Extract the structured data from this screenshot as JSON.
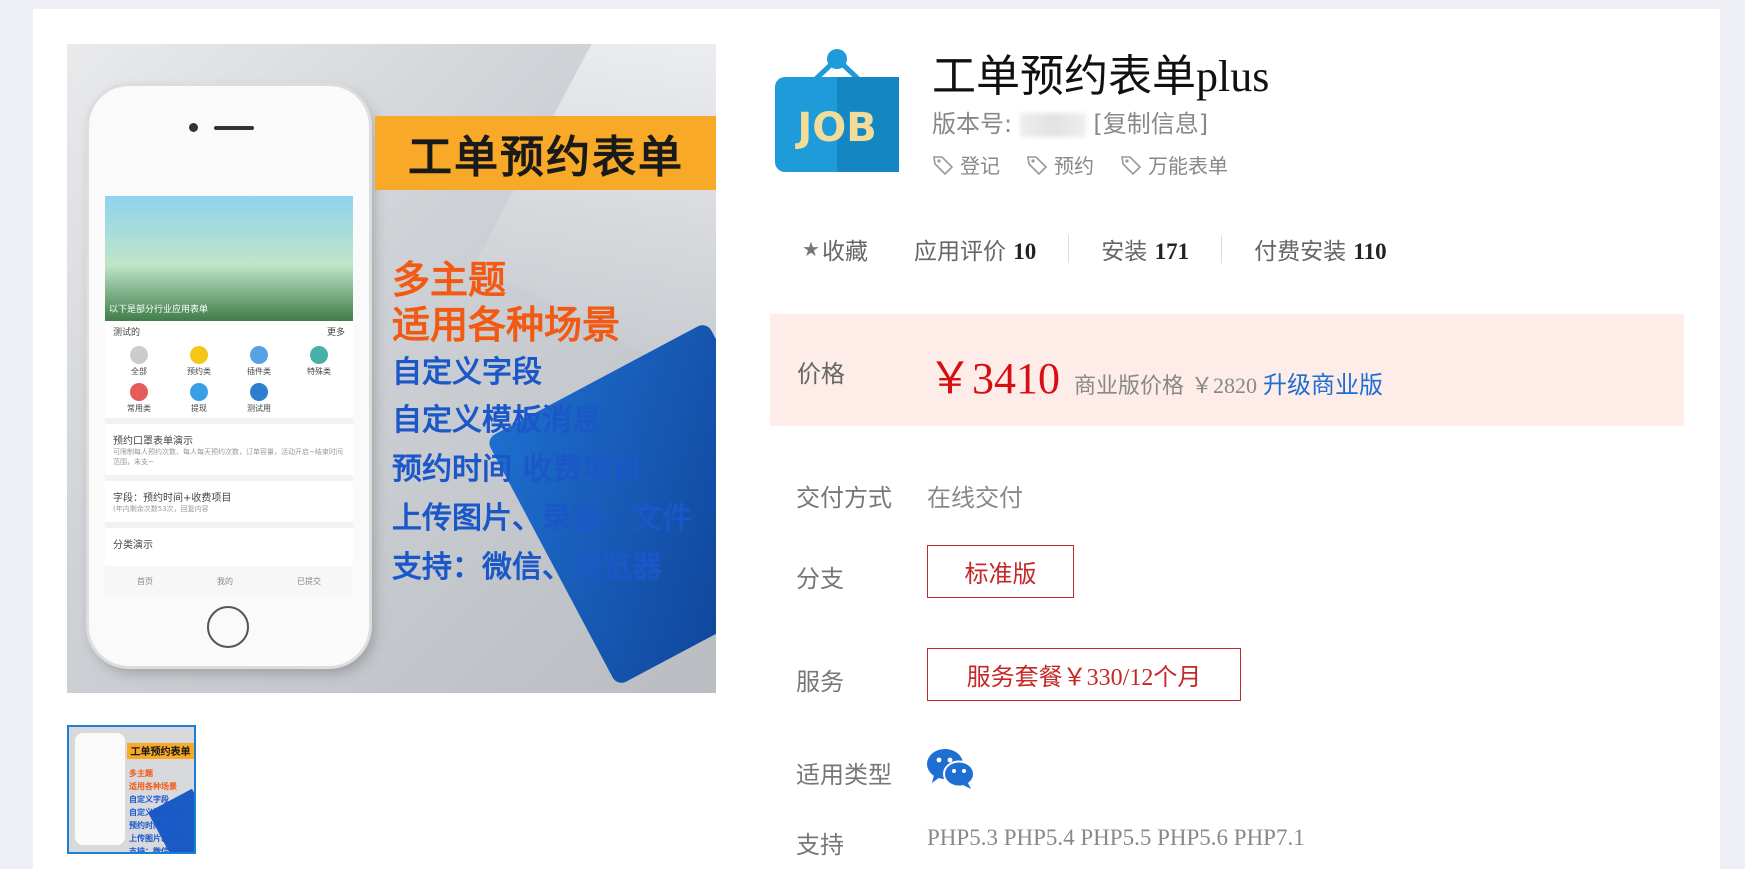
{
  "gallery": {
    "banner_title": "工单预约表单",
    "features": [
      "多主题",
      "适用各种场景",
      "自定义字段",
      "自定义模板消息",
      "预约时间 收费项目",
      "上传图片、录音、文件",
      "支持：微信、浏览器"
    ],
    "phone": {
      "banner_caption": "以下是部分行业应用表单",
      "notice": "测试的",
      "more": "更多",
      "grid": [
        "全部",
        "预约类",
        "插件类",
        "特殊类",
        "常用类",
        "提现",
        "测试用"
      ],
      "items": [
        {
          "title": "预约口罩表单演示",
          "sub": "可限制每人预约次数、每人每天预约次数，订单容量，活动开启~结束时间范围，未支~"
        },
        {
          "title": "字段：预约时间+收费项目",
          "sub": "(年内剩余次数53次，回复内容"
        },
        {
          "title": "分类演示",
          "sub": ""
        }
      ],
      "tabs": [
        "首页",
        "我的",
        "已提交"
      ]
    },
    "thumb_title": "工单预约表单",
    "thumb_lines": [
      "多主题",
      "适用各种场景",
      "自定义字段",
      "自定义模板消息",
      "预约时间 收费",
      "上传图片、录音",
      "支持：微信、浏览器"
    ]
  },
  "product": {
    "logo_text": "JOB",
    "title": "工单预约表单plus",
    "version_label": "版本号:",
    "copy_info": "[复制信息]",
    "tags": [
      "登记",
      "预约",
      "万能表单"
    ]
  },
  "stats": {
    "favorite": "收藏",
    "rating_label": "应用评价",
    "rating_value": "10",
    "installs_label": "安装",
    "installs_value": "171",
    "paid_label": "付费安装",
    "paid_value": "110"
  },
  "price": {
    "label": "价格",
    "main": "￥3410",
    "business_label": "商业版价格",
    "business_value": "￥2820",
    "upgrade": "升级商业版"
  },
  "details": {
    "delivery_label": "交付方式",
    "delivery_value": "在线交付",
    "branch_label": "分支",
    "branch_value": "标准版",
    "service_label": "服务",
    "service_value": "服务套餐￥330/12个月",
    "type_label": "适用类型",
    "support_label": "支持",
    "support_value": "PHP5.3 PHP5.4 PHP5.5 PHP5.6 PHP7.1"
  },
  "colors": {
    "accent_red": "#d60f14",
    "link_blue": "#1f6ed4",
    "price_bg": "#fdece8",
    "logo_blue": "#1e9bd8",
    "banner_orange": "#f8a927",
    "feature_orange": "#f25a13",
    "feature_blue": "#1a57c9"
  },
  "icons": {
    "favorite": "star-icon",
    "tag": "tag-icon",
    "type": "wechat-icon"
  }
}
